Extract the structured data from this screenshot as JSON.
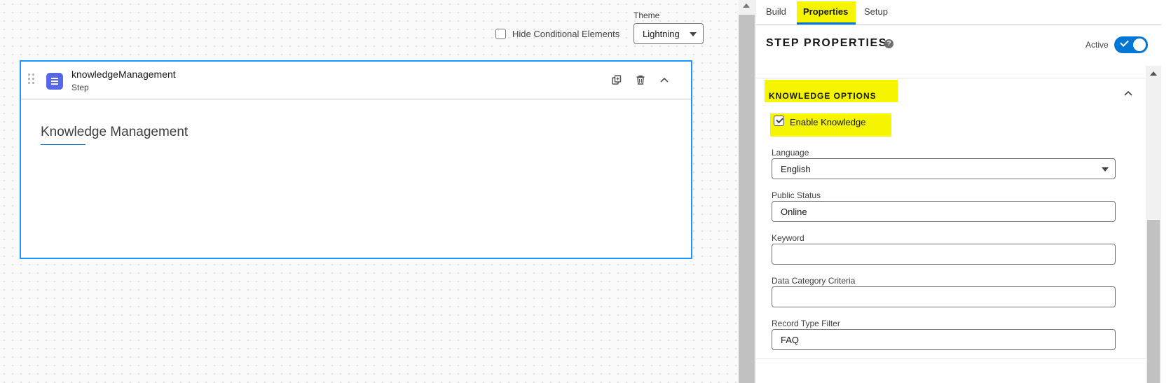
{
  "canvas": {
    "hide_conditional_label": "Hide Conditional Elements",
    "theme_label": "Theme",
    "theme_value": "Lightning",
    "step": {
      "name": "knowledgeManagement",
      "type": "Step",
      "title": "Knowledge Management",
      "actions": [
        "copy-icon",
        "trash-icon",
        "chevron-up-icon"
      ]
    }
  },
  "panel": {
    "tabs": [
      {
        "label": "Build",
        "active": false
      },
      {
        "label": "Properties",
        "active": true
      },
      {
        "label": "Setup",
        "active": false
      }
    ],
    "title": "STEP PROPERTIES",
    "help_glyph": "?",
    "active_label": "Active",
    "active_on": true,
    "section": {
      "title": "KNOWLEDGE OPTIONS",
      "enable_knowledge_label": "Enable Knowledge",
      "enable_knowledge_checked": true,
      "fields": [
        {
          "label": "Language",
          "value": "English",
          "type": "select"
        },
        {
          "label": "Public Status",
          "value": "Online",
          "type": "text"
        },
        {
          "label": "Keyword",
          "value": "",
          "type": "text"
        },
        {
          "label": "Data Category Criteria",
          "value": "",
          "type": "text"
        },
        {
          "label": "Record Type Filter",
          "value": "FAQ",
          "type": "text"
        }
      ]
    }
  },
  "colors": {
    "accent": "#0176d3",
    "step_icon": "#5867e8",
    "highlight": "#f5f500",
    "card_border": "#1b96ff"
  }
}
